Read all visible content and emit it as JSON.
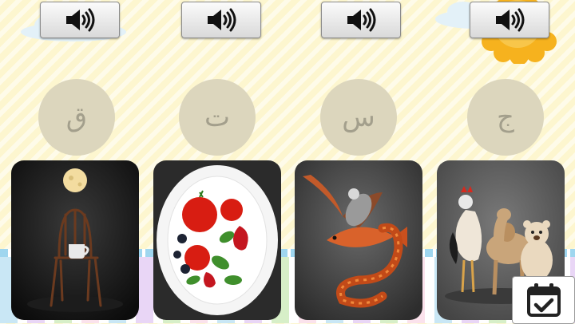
{
  "sound_buttons": [
    {
      "icon": "speaker-icon"
    },
    {
      "icon": "speaker-icon"
    },
    {
      "icon": "speaker-icon"
    },
    {
      "icon": "speaker-icon"
    }
  ],
  "letters": [
    "ق",
    "ت",
    "س",
    "ج"
  ],
  "cards": [
    {
      "image": "moon-chair-cup"
    },
    {
      "image": "tomatoes-strawberries-plate"
    },
    {
      "image": "eagle-fish-snake"
    },
    {
      "image": "rooster-camel-bear"
    }
  ],
  "check_button": {
    "icon": "calendar-check-icon"
  },
  "colors": {
    "background": "#fdf6cf",
    "circle": "#dcd6bd",
    "letter": "#a39f8c",
    "sun": "#f6b21e"
  }
}
